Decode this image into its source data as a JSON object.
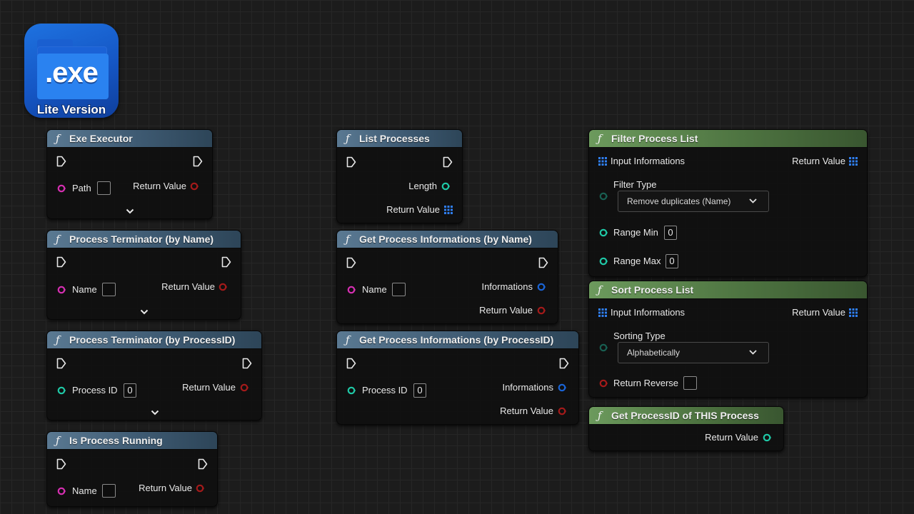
{
  "icon": {
    "main_text": ".exe",
    "sub_text": "Lite Version"
  },
  "nodes": {
    "exe_executor": {
      "title": "Exe Executor",
      "path": "Path",
      "return_value": "Return Value"
    },
    "list_processes": {
      "title": "List Processes",
      "length": "Length",
      "return_value": "Return Value"
    },
    "filter_process_list": {
      "title": "Filter Process List",
      "input": "Input Informations",
      "return_value": "Return Value",
      "filter_type": "Filter Type",
      "filter_value": "Remove duplicates (Name)",
      "range_min": "Range Min",
      "range_min_value": "0",
      "range_max": "Range Max",
      "range_max_value": "0"
    },
    "terminator_name": {
      "title": "Process Terminator (by Name)",
      "name": "Name",
      "return_value": "Return Value"
    },
    "get_info_name": {
      "title": "Get Process Informations (by Name)",
      "name": "Name",
      "informations": "Informations",
      "return_value": "Return Value"
    },
    "sort_process_list": {
      "title": "Sort Process List",
      "input": "Input Informations",
      "return_value": "Return Value",
      "sorting_type": "Sorting Type",
      "sorting_value": "Alphabetically",
      "return_reverse": "Return Reverse"
    },
    "terminator_pid": {
      "title": "Process Terminator (by ProcessID)",
      "process_id": "Process ID",
      "process_id_value": "0",
      "return_value": "Return Value"
    },
    "get_info_pid": {
      "title": "Get Process Informations (by ProcessID)",
      "process_id": "Process ID",
      "process_id_value": "0",
      "informations": "Informations",
      "return_value": "Return Value"
    },
    "get_pid_this": {
      "title": "Get ProcessID of THIS Process",
      "return_value": "Return Value"
    },
    "is_running": {
      "title": "Is Process Running",
      "name": "Name",
      "return_value": "Return Value"
    }
  },
  "colors": {
    "header_blue": "#3e5a72",
    "header_green": "#4e7441",
    "string_pin": "#d62fb2",
    "bool_pin": "#a41a1a",
    "int_pin": "#1fc8a6",
    "struct_pin": "#1a64d6",
    "array_pin": "#2f7ef0",
    "canvas_bg": "#1c1c1c"
  },
  "icons": {
    "function": "function-f-icon",
    "exec": "exec-pin-icon",
    "expand": "chevron-down-icon",
    "array": "array-grid-icon",
    "dropdown": "dropdown-arrow-icon"
  }
}
